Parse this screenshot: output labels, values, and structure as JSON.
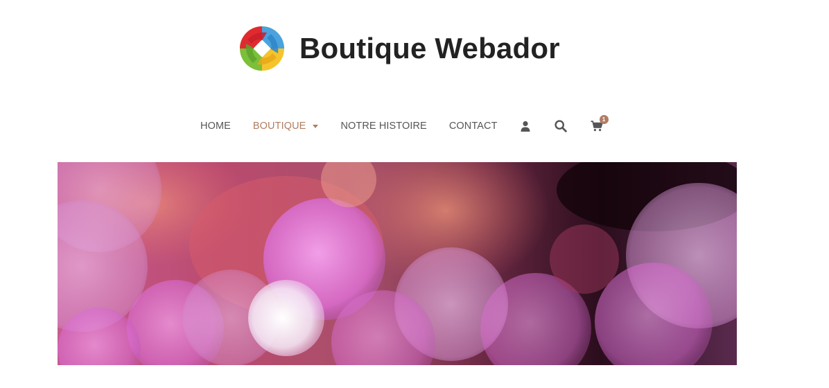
{
  "site": {
    "title": "Boutique Webador",
    "logo_icon": "webador-logo-icon"
  },
  "nav": {
    "items": [
      {
        "label": "HOME",
        "active": false
      },
      {
        "label": "BOUTIQUE",
        "active": true,
        "has_dropdown": true
      },
      {
        "label": "NOTRE HISTOIRE",
        "active": false
      },
      {
        "label": "CONTACT",
        "active": false
      }
    ],
    "icons": {
      "account": "user-icon",
      "search": "search-icon",
      "cart": "cart-icon"
    },
    "cart_count": "1"
  },
  "colors": {
    "accent": "#b07d62",
    "nav_text": "#555555",
    "title_text": "#222222"
  }
}
